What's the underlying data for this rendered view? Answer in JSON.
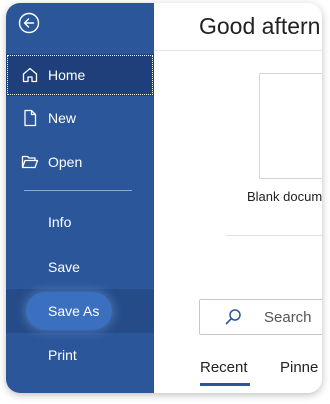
{
  "sidebar": {
    "back": {
      "icon": "back-arrow-icon"
    },
    "items": [
      {
        "label": "Home",
        "icon": "home-icon"
      },
      {
        "label": "New",
        "icon": "new-document-icon"
      },
      {
        "label": "Open",
        "icon": "folder-open-icon"
      },
      {
        "label": "Info"
      },
      {
        "label": "Save"
      },
      {
        "label": "Save As"
      },
      {
        "label": "Print"
      }
    ],
    "colors": {
      "background": "#2b579a",
      "selected": "#1e3f7a",
      "hover_pill": "#3b6fc0"
    }
  },
  "main": {
    "greeting": "Good aftern",
    "blank_document": {
      "label": "Blank docum"
    },
    "search": {
      "placeholder": "Search",
      "icon": "search-icon"
    },
    "tabs": [
      {
        "label": "Recent",
        "active": true
      },
      {
        "label": "Pinne",
        "active": false
      }
    ]
  }
}
